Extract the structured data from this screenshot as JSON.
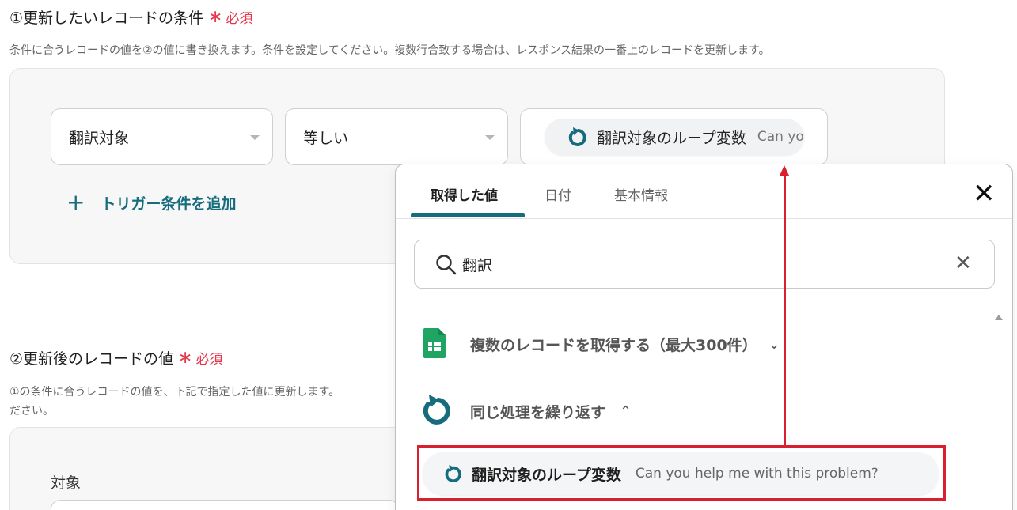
{
  "section1": {
    "title": "①更新したいレコードの条件",
    "required_label": "必須",
    "description": "条件に合うレコードの値を②の値に書き換えます。条件を設定してください。複数行合致する場合は、レスポンス結果の一番上のレコードを更新します。",
    "field_select": "翻訳対象",
    "operator_select": "等しい",
    "value_pill": {
      "label": "翻訳対象のループ変数",
      "value": "Can yo"
    },
    "add_condition_label": "トリガー条件を追加"
  },
  "section2": {
    "title": "②更新後のレコードの値",
    "required_label": "必須",
    "description_line1": "①の条件に合うレコードの値を、下記で指定した値に更新します。",
    "description_line2": "ださい。",
    "field_label": "対象"
  },
  "popup": {
    "tabs": [
      "取得した値",
      "日付",
      "基本情報"
    ],
    "active_tab": 0,
    "search_value": "翻訳",
    "groups": [
      {
        "label": "複数のレコードを取得する（最大300件）",
        "expanded": false,
        "icon": "google-sheets-icon"
      },
      {
        "label": "同じ処理を繰り返す",
        "expanded": true,
        "icon": "loop-icon"
      }
    ],
    "result": {
      "label": "翻訳対象のループ変数",
      "value": "Can you help me with this problem?"
    }
  },
  "colors": {
    "accent": "#166c7d",
    "required": "#e5384b",
    "highlight": "#d9202f",
    "sheets_green": "#1fa463"
  }
}
